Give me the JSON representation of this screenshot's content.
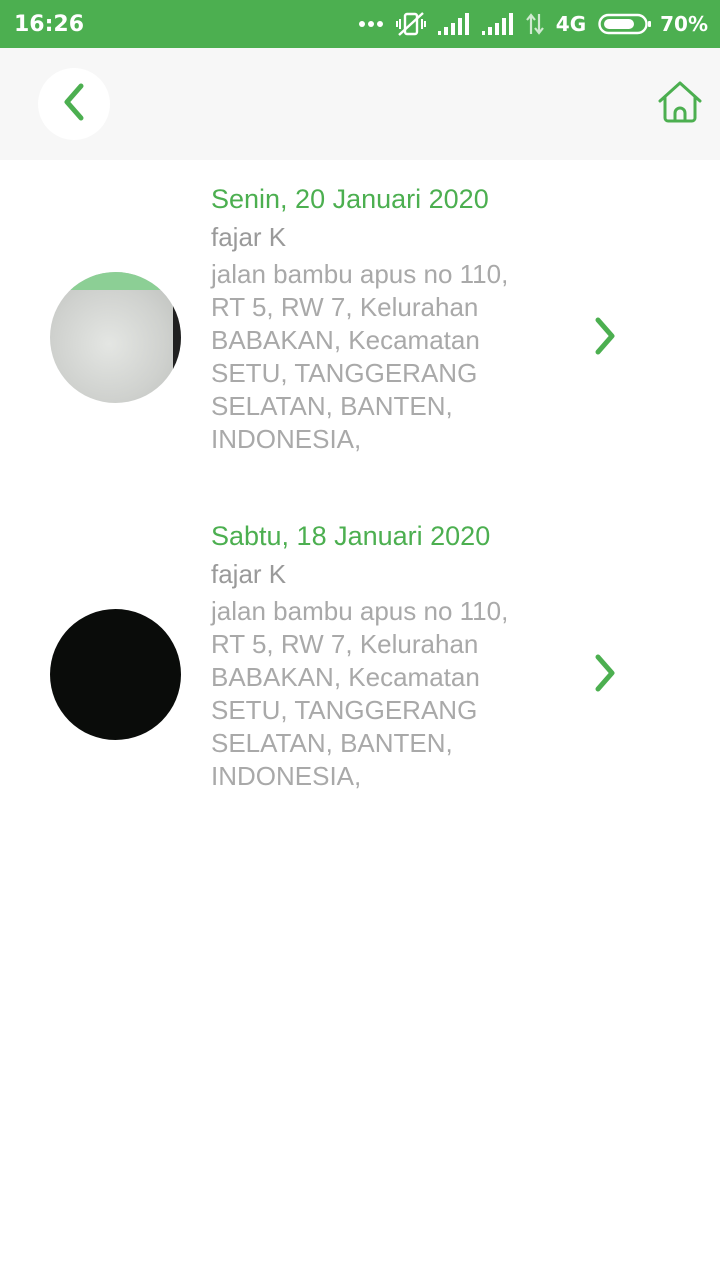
{
  "status_bar": {
    "time": "16:26",
    "network": "4G",
    "battery": "70%",
    "icons": [
      "more-dots-icon",
      "vibrate-off-icon",
      "signal-icon",
      "signal-icon",
      "data-transfer-icon",
      "battery-icon"
    ]
  },
  "toolbar": {
    "back_icon": "chevron-left-icon",
    "home_icon": "home-icon"
  },
  "colors": {
    "accent": "#4caf50",
    "toolbar_bg": "#f7f7f7",
    "secondary_text": "#a9a9a9"
  },
  "items": [
    {
      "date": "Senin, 20 Januari 2020",
      "name": "fajar K",
      "address": "jalan bambu apus no 110, RT 5, RW 7, Kelurahan BABAKAN, Kecamatan SETU, TANGGERANG SELATAN, BANTEN, INDONESIA,",
      "avatar": "photo-thumbnail",
      "action_icon": "chevron-right-icon"
    },
    {
      "date": "Sabtu, 18 Januari 2020",
      "name": "fajar K",
      "address": "jalan bambu apus no 110, RT 5, RW 7, Kelurahan BABAKAN, Kecamatan SETU, TANGGERANG SELATAN, BANTEN, INDONESIA,",
      "avatar": "dark-photo-thumbnail",
      "action_icon": "chevron-right-icon"
    }
  ]
}
